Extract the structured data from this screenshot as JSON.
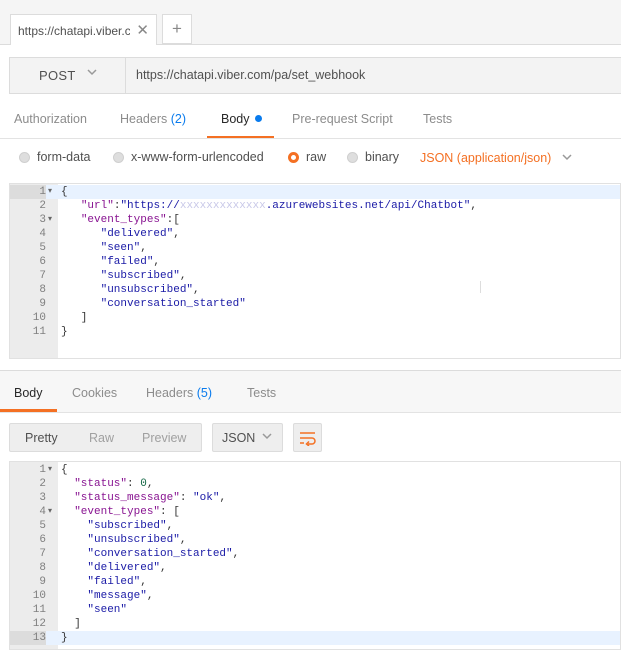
{
  "tabs": {
    "request_tab_title": "https://chatapi.viber.c",
    "close_glyph": "✕",
    "new_tab_glyph": "+"
  },
  "request": {
    "method": "POST",
    "url": "https://chatapi.viber.com/pa/set_webhook",
    "chevron": "⌵"
  },
  "request_tabs": [
    {
      "label": "Authorization"
    },
    {
      "label": "Headers",
      "count": "(2)"
    },
    {
      "label": "Body"
    },
    {
      "label": "Pre-request Script"
    },
    {
      "label": "Tests"
    }
  ],
  "body_modes": {
    "form_data": "form-data",
    "urlencoded": "x-www-form-urlencoded",
    "raw": "raw",
    "binary": "binary",
    "content_type": "JSON (application/json)",
    "selected": "raw"
  },
  "request_body": {
    "line_numbers": [
      "1",
      "2",
      "3",
      "4",
      "5",
      "6",
      "7",
      "8",
      "9",
      "10",
      "11"
    ],
    "url_key": "\"url\"",
    "url_prefix": "\"https://",
    "url_blurred": "xxxxxxxxxxxxx",
    "url_suffix": ".azurewebsites.net/api/Chatbot\"",
    "event_types_key": "\"event_types\"",
    "event_types": [
      "\"delivered\"",
      "\"seen\"",
      "\"failed\"",
      "\"subscribed\"",
      "\"unsubscribed\"",
      "\"conversation_started\""
    ]
  },
  "response_tabs": [
    {
      "label": "Body"
    },
    {
      "label": "Cookies"
    },
    {
      "label": "Headers",
      "count": "(5)"
    },
    {
      "label": "Tests"
    }
  ],
  "response_view": {
    "pretty": "Pretty",
    "raw": "Raw",
    "preview": "Preview",
    "format": "JSON"
  },
  "response_body": {
    "line_numbers": [
      "1",
      "2",
      "3",
      "4",
      "5",
      "6",
      "7",
      "8",
      "9",
      "10",
      "11",
      "12",
      "13"
    ],
    "status_key": "\"status\"",
    "status_value": "0",
    "status_message_key": "\"status_message\"",
    "status_message_value": "\"ok\"",
    "event_types_key": "\"event_types\"",
    "event_types": [
      "\"subscribed\"",
      "\"unsubscribed\"",
      "\"conversation_started\"",
      "\"delivered\"",
      "\"failed\"",
      "\"message\"",
      "\"seen\""
    ]
  },
  "colors": {
    "accent": "#f47023",
    "link_blue": "#097bed"
  },
  "icons": {
    "wrap": "text-wrap-icon",
    "close": "close-icon",
    "plus": "plus-icon"
  }
}
